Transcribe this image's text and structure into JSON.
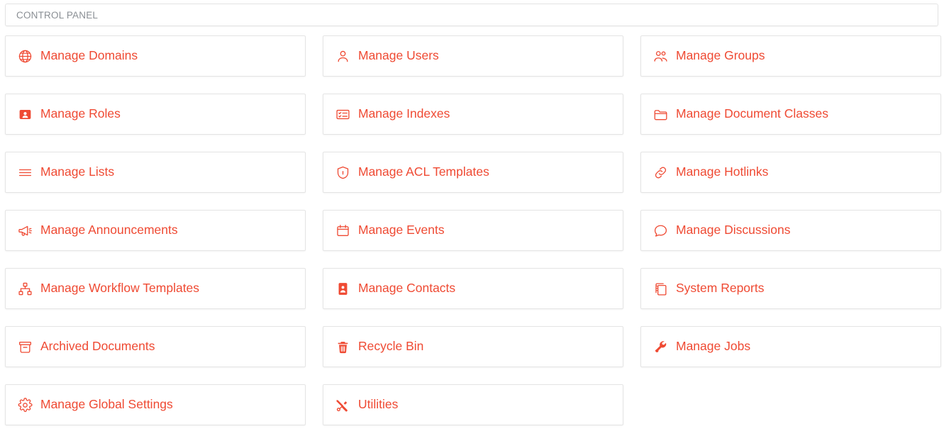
{
  "header": {
    "title": "CONTROL PANEL"
  },
  "colors": {
    "accent": "#ef4a33",
    "card_border": "#e4e4e4",
    "header_border": "#e3e3e3",
    "header_text": "#8a8f94",
    "background": "#ffffff"
  },
  "cards": [
    {
      "label": "Manage Domains",
      "icon": "globe-icon"
    },
    {
      "label": "Manage Users",
      "icon": "user-icon"
    },
    {
      "label": "Manage Groups",
      "icon": "users-group-icon"
    },
    {
      "label": "Manage Roles",
      "icon": "id-card-filled-icon"
    },
    {
      "label": "Manage Indexes",
      "icon": "list-card-icon"
    },
    {
      "label": "Manage Document Classes",
      "icon": "folder-icon"
    },
    {
      "label": "Manage Lists",
      "icon": "list-lines-icon"
    },
    {
      "label": "Manage ACL Templates",
      "icon": "shield-icon"
    },
    {
      "label": "Manage Hotlinks",
      "icon": "link-icon"
    },
    {
      "label": "Manage Announcements",
      "icon": "megaphone-icon"
    },
    {
      "label": "Manage Events",
      "icon": "calendar-icon"
    },
    {
      "label": "Manage Discussions",
      "icon": "speech-bubble-icon"
    },
    {
      "label": "Manage Workflow Templates",
      "icon": "sitemap-icon"
    },
    {
      "label": "Manage Contacts",
      "icon": "contact-card-filled-icon"
    },
    {
      "label": "System Reports",
      "icon": "copy-pages-icon"
    },
    {
      "label": "Archived Documents",
      "icon": "archive-box-icon"
    },
    {
      "label": "Recycle Bin",
      "icon": "trash-icon"
    },
    {
      "label": "Manage Jobs",
      "icon": "wrench-icon"
    },
    {
      "label": "Manage Global Settings",
      "icon": "gear-icon"
    },
    {
      "label": "Utilities",
      "icon": "tools-cross-icon"
    }
  ]
}
